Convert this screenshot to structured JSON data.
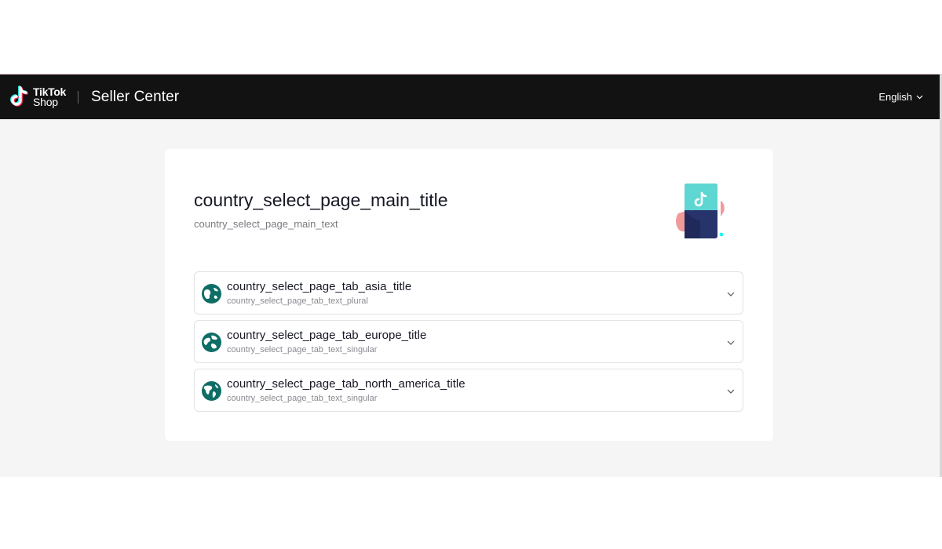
{
  "header": {
    "logo_line1": "TikTok",
    "logo_line2": "Shop",
    "app_title": "Seller Center",
    "language": "English"
  },
  "main": {
    "title": "country_select_page_main_title",
    "text": "country_select_page_main_text"
  },
  "regions": [
    {
      "title": "country_select_page_tab_asia_title",
      "subtitle": "country_select_page_tab_text_plural"
    },
    {
      "title": "country_select_page_tab_europe_title",
      "subtitle": "country_select_page_tab_text_singular"
    },
    {
      "title": "country_select_page_tab_north_america_title",
      "subtitle": "country_select_page_tab_text_singular"
    }
  ],
  "icons": {
    "logo": "tiktok-note-icon",
    "language_caret": "chevron-down-icon",
    "hero": "phone-in-hand-illustration",
    "region_globe": "globe-icon",
    "region_expand": "chevron-down-icon"
  },
  "colors": {
    "header_bg": "#121212",
    "page_bg": "#f5f5f5",
    "card_bg": "#ffffff",
    "globe": "#0e6e66",
    "accent_cyan": "#25f4ee",
    "accent_red": "#fe2c55"
  }
}
